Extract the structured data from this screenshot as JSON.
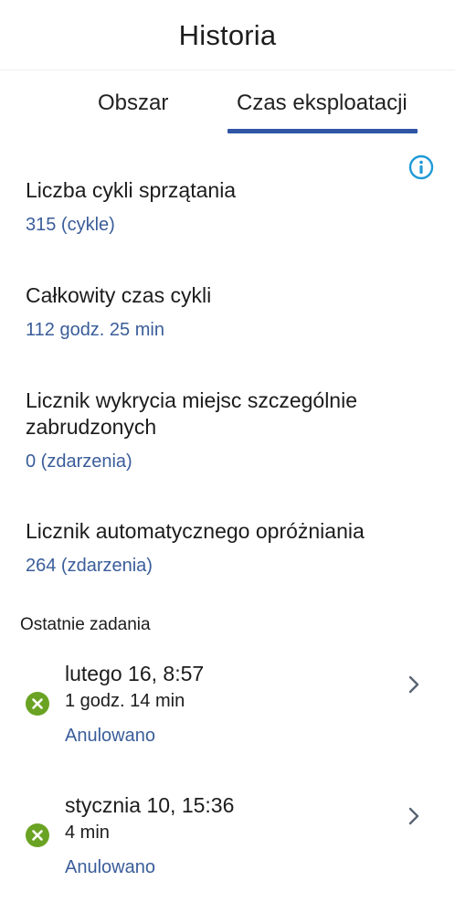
{
  "header": {
    "title": "Historia"
  },
  "tabs": [
    {
      "label": "Obszar",
      "active": false
    },
    {
      "label": "Czas eksploatacji",
      "active": true
    }
  ],
  "colors": {
    "accent": "#2f55a4",
    "value_text": "#3a5d9a",
    "info_icon": "#1f9ad6",
    "status_cancelled": "#6aa323"
  },
  "stats": [
    {
      "label": "Liczba cykli sprzątania",
      "value": "315 (cykle)"
    },
    {
      "label": "Całkowity czas cykli",
      "value": "112 godz. 25 min"
    },
    {
      "label": "Licznik wykrycia miejsc szczególnie zabrudzonych",
      "value": "0 (zdarzenia)"
    },
    {
      "label": "Licznik automatycznego opróżniania",
      "value": "264 (zdarzenia)"
    }
  ],
  "recent": {
    "heading": "Ostatnie zadania",
    "tasks": [
      {
        "date": "lutego 16, 8:57",
        "duration": "1 godz. 14 min",
        "result": "Anulowano",
        "status_icon": "cancelled-x-icon"
      },
      {
        "date": "stycznia 10, 15:36",
        "duration": "4 min",
        "result": "Anulowano",
        "status_icon": "cancelled-x-icon"
      }
    ]
  }
}
